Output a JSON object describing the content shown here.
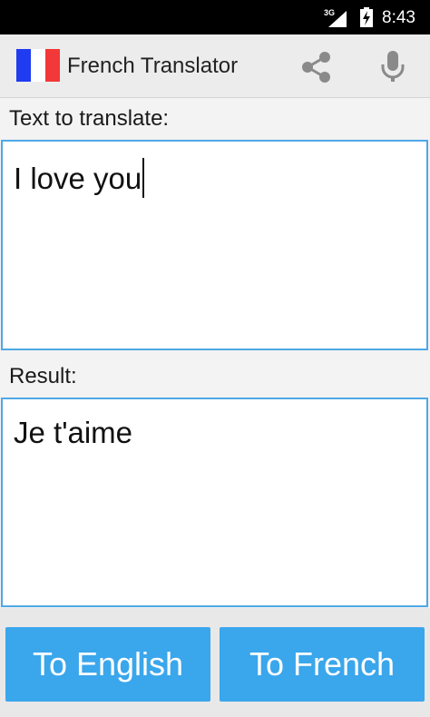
{
  "status_bar": {
    "network": "3G",
    "time": "8:43"
  },
  "action_bar": {
    "title": "French Translator",
    "flag_colors": [
      "#1f3cf0",
      "#ffffff",
      "#f23838"
    ],
    "actions": [
      {
        "icon": "share-icon"
      },
      {
        "icon": "microphone-icon"
      }
    ]
  },
  "input": {
    "label": "Text to translate:",
    "value": "I love you"
  },
  "result": {
    "label": "Result:",
    "value": "Je t'aime"
  },
  "buttons": {
    "to_english": "To English",
    "to_french": "To French"
  },
  "colors": {
    "accent": "#3aa6ec",
    "border": "#4fa8e6"
  }
}
